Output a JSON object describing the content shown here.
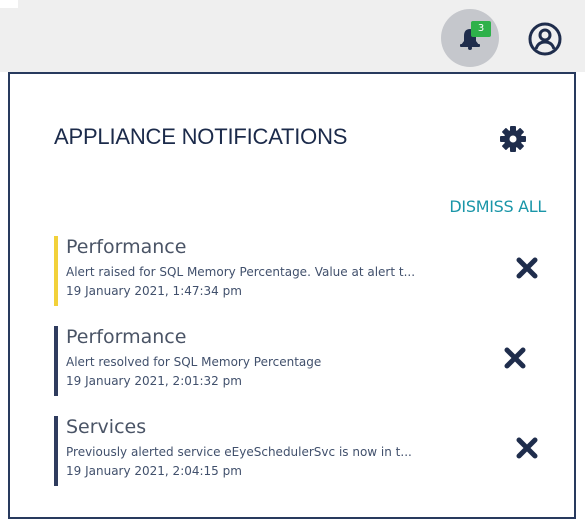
{
  "header": {
    "notification_count": "3",
    "icons": [
      "bell-icon",
      "user-icon"
    ]
  },
  "panel": {
    "title": "APPLIANCE NOTIFICATIONS",
    "settings_icon": "gear-icon",
    "dismiss_all_label": "DISMISS ALL",
    "notifications": [
      {
        "category": "Performance",
        "message": "Alert raised for SQL Memory Percentage. Value at alert t...",
        "timestamp": "19 January 2021, 1:47:34 pm",
        "severity": "warning"
      },
      {
        "category": "Performance",
        "message": "Alert resolved for SQL Memory Percentage",
        "timestamp": "19 January 2021, 2:01:32 pm",
        "severity": "info"
      },
      {
        "category": "Services",
        "message": "Previously alerted service eEyeSchedulerSvc is now in t...",
        "timestamp": "19 January 2021, 2:04:15 pm",
        "severity": "info"
      }
    ]
  },
  "colors": {
    "accent": "#1a96a8",
    "badge": "#2eb14a",
    "warning_bar": "#f2d13a",
    "info_bar": "#2f3c5e",
    "panel_border": "#283a5e"
  }
}
